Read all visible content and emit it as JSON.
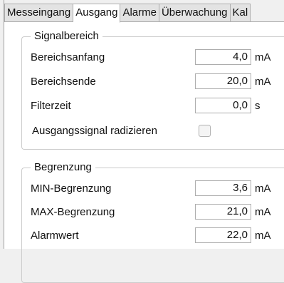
{
  "tabs": [
    {
      "label": "Messeingang",
      "active": false
    },
    {
      "label": "Ausgang",
      "active": true
    },
    {
      "label": "Alarme",
      "active": false
    },
    {
      "label": "Überwachung",
      "active": false
    },
    {
      "label": "Kal",
      "active": false
    }
  ],
  "signalbereich": {
    "title": "Signalbereich",
    "bereichsanfang": {
      "label": "Bereichsanfang",
      "value": "4,0",
      "unit": "mA"
    },
    "bereichsende": {
      "label": "Bereichsende",
      "value": "20,0",
      "unit": "mA"
    },
    "filterzeit": {
      "label": "Filterzeit",
      "value": "0,0",
      "unit": "s"
    },
    "radizieren": {
      "label": "Ausgangssignal radizieren",
      "checked": false
    }
  },
  "begrenzung": {
    "title": "Begrenzung",
    "min": {
      "label": "MIN-Begrenzung",
      "value": "3,6",
      "unit": "mA"
    },
    "max": {
      "label": "MAX-Begrenzung",
      "value": "21,0",
      "unit": "mA"
    },
    "alarm": {
      "label": "Alarmwert",
      "value": "22,0",
      "unit": "mA"
    }
  }
}
